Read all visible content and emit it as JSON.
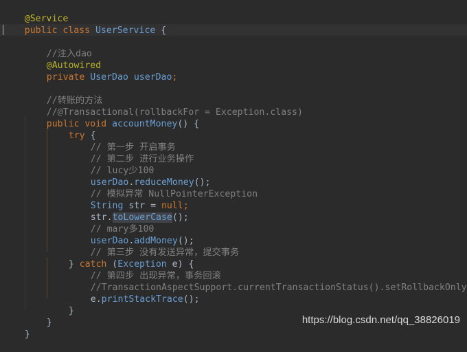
{
  "code": {
    "l01_annotation": "@Service",
    "l02_kw": "public class ",
    "l02_class": "UserService",
    "l02_brace": " {",
    "l04_comment": "//注入dao",
    "l05_annotation": "@Autowired",
    "l06_kw": "private ",
    "l06_type": "UserDao",
    "l06_field": " userDao",
    "l06_semi": ";",
    "l08_comment": "//转账的方法",
    "l09_comment": "//@Transactional(rollbackFor = Exception.class)",
    "l10_kw": "public void ",
    "l10_method": "accountMoney",
    "l10_rest": "() {",
    "l11_kw": "try",
    "l11_rest": " {",
    "l12_comment": "// 第一步 开启事务",
    "l13_comment": "// 第二步 进行业务操作",
    "l14_comment": "// lucy少100",
    "l15_field": "userDao",
    "l15_dot": ".",
    "l15_method": "reduceMoney",
    "l15_rest": "();",
    "l16_comment": "// 模拟异常 NullPointerException",
    "l17_type": "String",
    "l17_rest": " str = ",
    "l17_null": "null",
    "l17_semi": ";",
    "l18_var": "str.",
    "l18_method": "toLowerCase",
    "l18_rest": "();",
    "l19_comment": "// mary多100",
    "l20_field": "userDao",
    "l20_dot": ".",
    "l20_method": "addMoney",
    "l20_rest": "();",
    "l21_comment": "// 第三步 没有发送异常，提交事务",
    "l22_brace": "} ",
    "l22_kw": "catch",
    "l22_paren": " (",
    "l22_type": "Exception",
    "l22_rest": " e) {",
    "l23_comment": "// 第四步 出现异常，事务回滚",
    "l24_comment": "//TransactionAspectSupport.currentTransactionStatus().setRollbackOnly();",
    "l25_var": "e.",
    "l25_method": "printStackTrace",
    "l25_rest": "();",
    "l26_brace": "}",
    "l27_brace": "}",
    "l28_brace": "}"
  },
  "watermark": "https://blog.csdn.net/qq_38826019",
  "colors": {
    "background": "#2b2b2b",
    "keyword": "#cc7832",
    "annotation": "#bbb529",
    "comment": "#808080",
    "field": "#9876aa",
    "text": "#a9b7c6"
  }
}
